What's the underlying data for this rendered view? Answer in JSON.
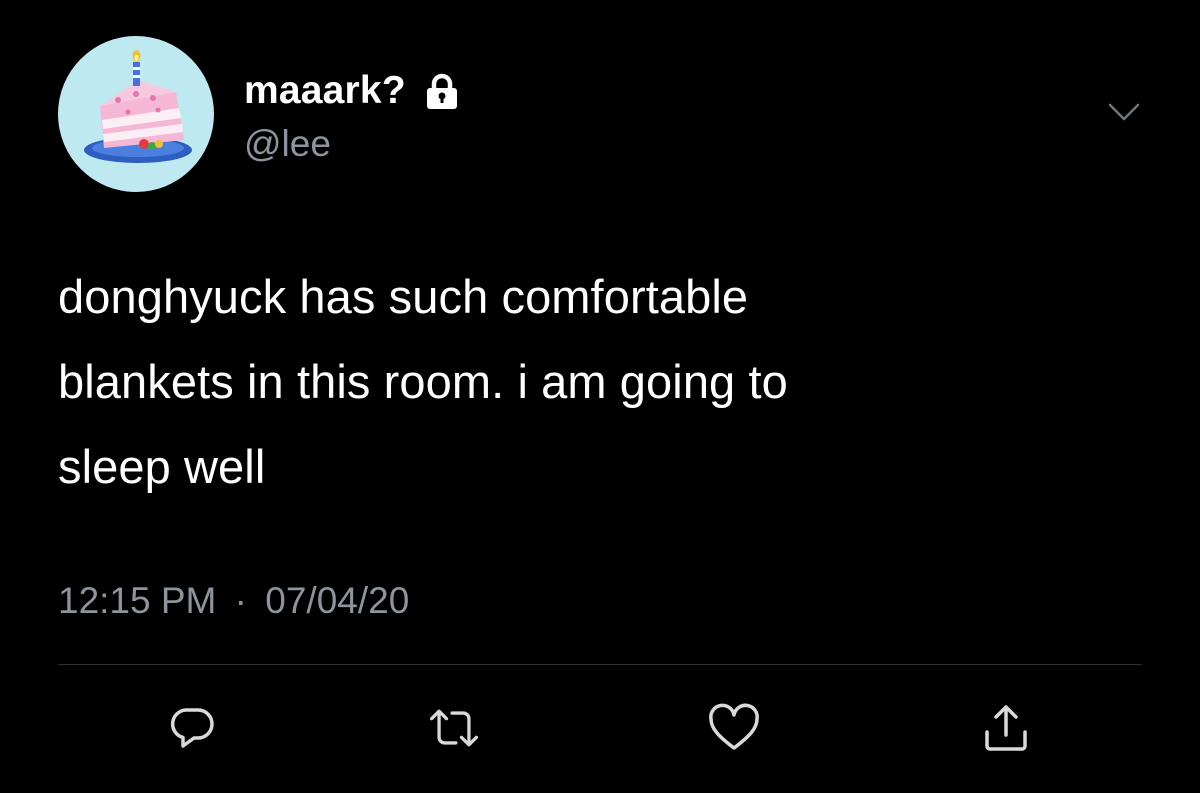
{
  "user": {
    "display_name": "maaark?",
    "handle": "@lee",
    "avatar_icon": "birthday-cake-icon",
    "protected_icon": "lock-icon"
  },
  "menu": {
    "icon": "chevron-down-icon"
  },
  "tweet": {
    "text": "donghyuck has such comfortable\nblankets in this room. i am going to\nsleep well",
    "time": "12:15 PM",
    "separator": "·",
    "date": "07/04/20"
  },
  "actions": [
    {
      "name": "reply",
      "icon": "reply-icon"
    },
    {
      "name": "retweet",
      "icon": "retweet-icon"
    },
    {
      "name": "like",
      "icon": "heart-icon"
    },
    {
      "name": "share",
      "icon": "share-icon"
    }
  ],
  "colors": {
    "background": "#000000",
    "text": "#ffffff",
    "secondary_text": "#8c959e",
    "divider": "#2f3336",
    "avatar_bg": "#bfe9f1"
  }
}
